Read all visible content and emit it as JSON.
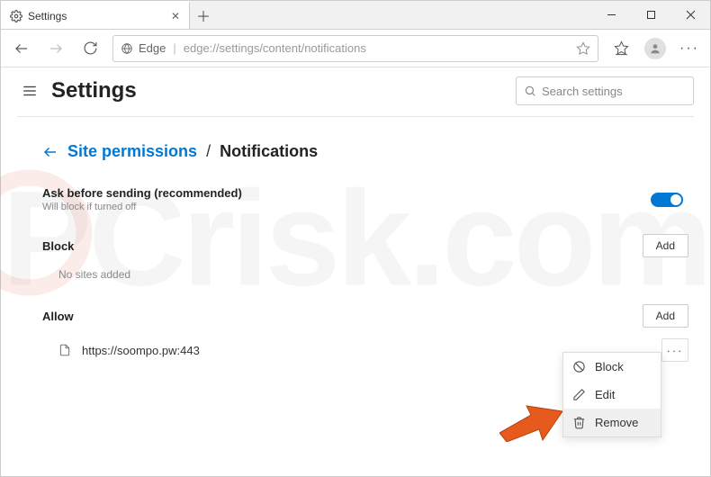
{
  "window": {
    "tab_title": "Settings",
    "addr_label": "Edge",
    "addr_url": "edge://settings/content/notifications"
  },
  "header": {
    "title": "Settings",
    "search_placeholder": "Search settings"
  },
  "breadcrumb": {
    "parent": "Site permissions",
    "current": "Notifications"
  },
  "ask": {
    "title": "Ask before sending (recommended)",
    "subtitle": "Will block if turned off",
    "toggle_on": true
  },
  "block": {
    "title": "Block",
    "add_label": "Add",
    "empty_text": "No sites added"
  },
  "allow": {
    "title": "Allow",
    "add_label": "Add",
    "items": [
      {
        "url": "https://soompo.pw:443"
      }
    ]
  },
  "context_menu": {
    "block": "Block",
    "edit": "Edit",
    "remove": "Remove"
  }
}
